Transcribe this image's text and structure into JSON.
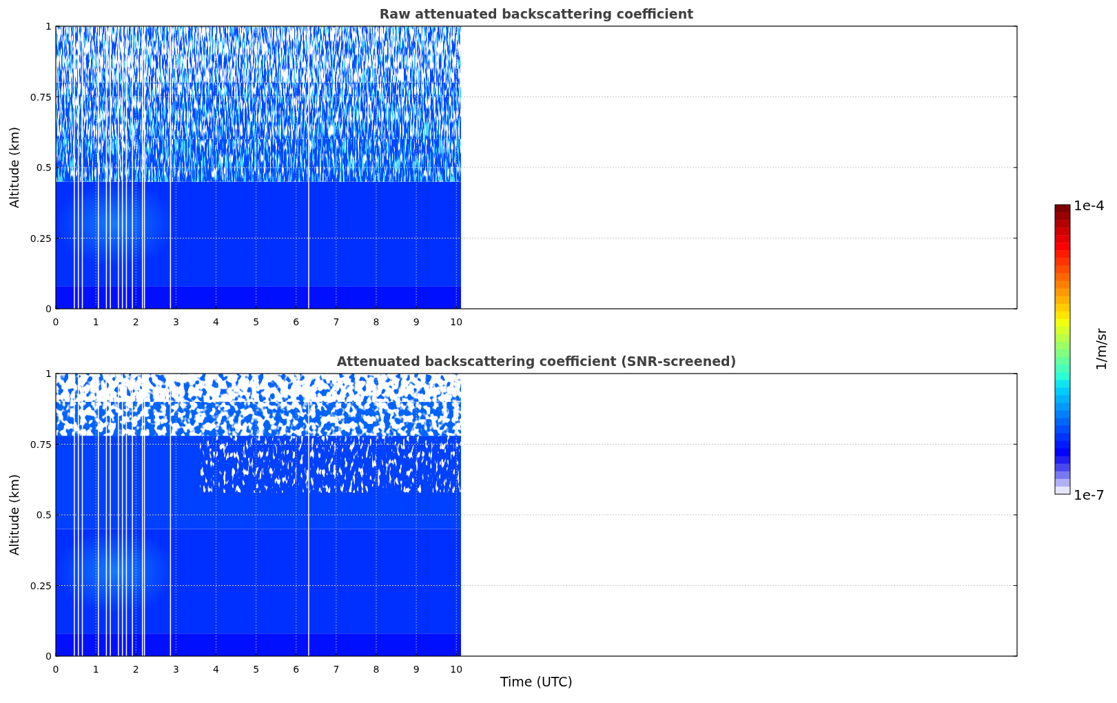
{
  "panels": [
    {
      "kind": "raw",
      "title": "Raw attenuated backscattering coefficient",
      "ylabel": "Altitude (km)",
      "yticks": [
        "1",
        "0.75",
        "0.5",
        "0.25",
        "0"
      ],
      "xticks": [
        "0",
        "1",
        "2",
        "3",
        "4",
        "5",
        "6",
        "7",
        "8",
        "9",
        "10"
      ]
    },
    {
      "kind": "screened",
      "title": "Attenuated backscattering coefficient (SNR-screened)",
      "ylabel": "Altitude (km)",
      "yticks": [
        "1",
        "0.75",
        "0.5",
        "0.25",
        "0"
      ],
      "xticks": [
        "0",
        "1",
        "2",
        "3",
        "4",
        "5",
        "6",
        "7",
        "8",
        "9",
        "10"
      ]
    }
  ],
  "xlabel": "Time (UTC)",
  "colorbar": {
    "label": "1/m/sr",
    "max_label": "1e-4",
    "min_label": "1e-7"
  }
}
